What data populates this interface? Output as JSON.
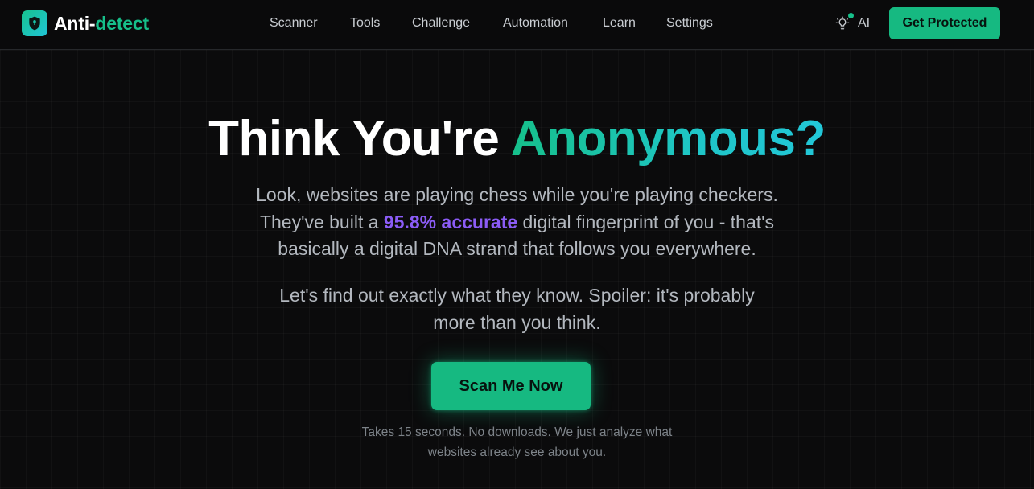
{
  "header": {
    "brand_part1": "Anti-",
    "brand_part2": "detect",
    "nav": [
      "Scanner",
      "Tools",
      "Challenge",
      "Automation",
      "Learn",
      "Settings"
    ],
    "ai_label": "AI",
    "cta_label": "Get Protected"
  },
  "hero": {
    "title_part1": "Think You're ",
    "title_part2": "Anonymous?",
    "para1_line1": "Look, websites are playing chess while you're playing checkers.",
    "para1_line2_pre": "They've built a ",
    "para1_highlight": "95.8% accurate",
    "para1_line2_post": " digital fingerprint of you - that's",
    "para1_line3": "basically a digital DNA strand that follows you everywhere.",
    "para2_line1": "Let's find out exactly what they know. Spoiler: it's probably",
    "para2_line2": "more than you think.",
    "scan_button": "Scan Me Now",
    "note_line1": "Takes 15 seconds. No downloads. We just analyze what",
    "note_line2": "websites already see about you."
  },
  "icons": {
    "logo": "shield-icon",
    "ai": "lightbulb-icon"
  },
  "colors": {
    "background": "#0b0b0c",
    "brand_green": "#16c08a",
    "brand_cyan": "#22c7d8",
    "button_green": "#16b981",
    "accent_purple": "#8b5cf6",
    "body_text": "#b3b8bf",
    "muted_text": "#7d8389"
  }
}
